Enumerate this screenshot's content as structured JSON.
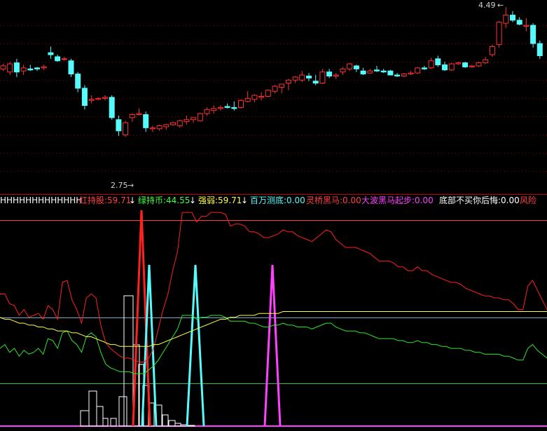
{
  "colors": {
    "background": "#000000",
    "bull": "#ff3232",
    "bear": "#54fcfc",
    "panel_divider": "#b80000",
    "dotted_grid": "#8b0000",
    "red_line": "#ff2020",
    "green_line": "#2ee62e",
    "yellow_line": "#ffff44",
    "white_bars": "#ffffff",
    "cyan_spike": "#54fcfc",
    "magenta_spike": "#ff40ff",
    "ref_line_upper": "#ff4040",
    "ref_line_mid": "#78a8c8",
    "ref_line_lower": "#40c040",
    "baseline": "#ff40ff"
  },
  "price_panel": {
    "high_label": "4.49",
    "low_label": "2.75",
    "high_arrow": "←",
    "low_arrow": "→"
  },
  "indicator_legend": [
    {
      "text": "HHHHHHHHHHHHH",
      "color": "#ffffff"
    },
    {
      "text": "红持股:59.71",
      "color": "#ff4040"
    },
    {
      "text": "↓",
      "color": "#ffffff"
    },
    {
      "text": "绿持币:44.55",
      "color": "#40ff40"
    },
    {
      "text": "↓",
      "color": "#ffffff"
    },
    {
      "text": "强弱:59.71",
      "color": "#ffff44"
    },
    {
      "text": "↓",
      "color": "#ffffff"
    },
    {
      "text": "百万测底:0.00",
      "color": "#54fcfc"
    },
    {
      "text": "灵桥黑马:0.00",
      "color": "#ff4040"
    },
    {
      "text": "大波黑马起步:0.00",
      "color": "#ff40ff"
    },
    {
      "text": "底部不买你后悔:0.00",
      "color": "#ffffff"
    },
    {
      "text": "风险",
      "color": "#ff4040"
    }
  ],
  "chart_data": [
    {
      "type": "candlestick",
      "title": "",
      "ylim": [
        2.75,
        4.49
      ],
      "annotations": [
        {
          "text": "4.49",
          "at": "high"
        },
        {
          "text": "2.75",
          "at": "low"
        }
      ],
      "ohlc": [
        [
          3.88,
          3.93,
          3.86,
          3.91
        ],
        [
          3.85,
          3.95,
          3.82,
          3.93
        ],
        [
          3.94,
          3.98,
          3.8,
          3.85
        ],
        [
          3.86,
          3.92,
          3.82,
          3.89
        ],
        [
          3.88,
          3.92,
          3.86,
          3.87
        ],
        [
          3.89,
          3.9,
          3.86,
          3.88
        ],
        [
          3.89,
          3.92,
          3.87,
          3.9
        ],
        [
          4.04,
          4.1,
          3.98,
          4.02
        ],
        [
          4.0,
          4.02,
          3.95,
          3.96
        ],
        [
          3.98,
          4.0,
          3.96,
          3.98
        ],
        [
          3.96,
          3.98,
          3.8,
          3.83
        ],
        [
          3.83,
          3.85,
          3.65,
          3.69
        ],
        [
          3.69,
          3.72,
          3.48,
          3.52
        ],
        [
          3.57,
          3.62,
          3.54,
          3.58
        ],
        [
          3.58,
          3.6,
          3.57,
          3.59
        ],
        [
          3.59,
          3.62,
          3.57,
          3.6
        ],
        [
          3.6,
          3.62,
          3.38,
          3.4
        ],
        [
          3.38,
          3.42,
          3.22,
          3.27
        ],
        [
          3.23,
          3.37,
          3.21,
          3.35
        ],
        [
          3.4,
          3.44,
          3.36,
          3.43
        ],
        [
          3.43,
          3.49,
          3.42,
          3.44
        ],
        [
          3.43,
          3.46,
          3.26,
          3.3
        ],
        [
          3.29,
          3.32,
          3.26,
          3.3
        ],
        [
          3.29,
          3.33,
          3.27,
          3.32
        ],
        [
          3.31,
          3.34,
          3.28,
          3.33
        ],
        [
          3.33,
          3.36,
          3.32,
          3.35
        ],
        [
          3.32,
          3.38,
          3.3,
          3.37
        ],
        [
          3.36,
          3.42,
          3.33,
          3.38
        ],
        [
          3.38,
          3.4,
          3.35,
          3.4
        ],
        [
          3.37,
          3.45,
          3.36,
          3.44
        ],
        [
          3.44,
          3.5,
          3.42,
          3.48
        ],
        [
          3.47,
          3.52,
          3.44,
          3.49
        ],
        [
          3.49,
          3.52,
          3.47,
          3.5
        ],
        [
          3.51,
          3.54,
          3.49,
          3.5
        ],
        [
          3.5,
          3.56,
          3.47,
          3.49
        ],
        [
          3.5,
          3.58,
          3.49,
          3.57
        ],
        [
          3.56,
          3.66,
          3.55,
          3.59
        ],
        [
          3.58,
          3.63,
          3.55,
          3.62
        ],
        [
          3.6,
          3.65,
          3.57,
          3.61
        ],
        [
          3.61,
          3.68,
          3.6,
          3.67
        ],
        [
          3.66,
          3.72,
          3.64,
          3.71
        ],
        [
          3.7,
          3.73,
          3.64,
          3.73
        ],
        [
          3.74,
          3.78,
          3.67,
          3.77
        ],
        [
          3.77,
          3.81,
          3.74,
          3.8
        ],
        [
          3.77,
          3.86,
          3.75,
          3.82
        ],
        [
          3.81,
          3.84,
          3.76,
          3.79
        ],
        [
          3.76,
          3.82,
          3.72,
          3.74
        ],
        [
          3.74,
          3.88,
          3.73,
          3.85
        ],
        [
          3.85,
          3.88,
          3.79,
          3.81
        ],
        [
          3.81,
          3.84,
          3.78,
          3.82
        ],
        [
          3.85,
          3.9,
          3.82,
          3.88
        ],
        [
          3.88,
          3.94,
          3.86,
          3.93
        ],
        [
          3.91,
          3.92,
          3.85,
          3.88
        ],
        [
          3.86,
          3.89,
          3.82,
          3.83
        ],
        [
          3.84,
          3.88,
          3.83,
          3.86
        ],
        [
          3.87,
          3.91,
          3.85,
          3.86
        ],
        [
          3.86,
          3.88,
          3.84,
          3.85
        ],
        [
          3.86,
          3.87,
          3.82,
          3.82
        ],
        [
          3.82,
          3.84,
          3.8,
          3.81
        ],
        [
          3.81,
          3.84,
          3.8,
          3.83
        ],
        [
          3.83,
          3.86,
          3.82,
          3.84
        ],
        [
          3.84,
          3.9,
          3.83,
          3.89
        ],
        [
          3.89,
          3.91,
          3.87,
          3.88
        ],
        [
          3.89,
          3.99,
          3.88,
          3.96
        ],
        [
          3.98,
          4.01,
          3.9,
          3.92
        ],
        [
          3.92,
          3.95,
          3.86,
          3.87
        ],
        [
          3.87,
          3.94,
          3.86,
          3.93
        ],
        [
          3.93,
          3.95,
          3.92,
          3.94
        ],
        [
          3.94,
          3.95,
          3.89,
          3.9
        ],
        [
          3.9,
          3.92,
          3.89,
          3.91
        ],
        [
          3.91,
          3.95,
          3.9,
          3.94
        ],
        [
          3.94,
          4.0,
          3.93,
          3.97
        ],
        [
          4.02,
          4.12,
          4.0,
          4.1
        ],
        [
          4.12,
          4.35,
          4.09,
          4.34
        ],
        [
          4.33,
          4.49,
          4.28,
          4.41
        ],
        [
          4.41,
          4.45,
          4.34,
          4.36
        ],
        [
          4.36,
          4.39,
          4.31,
          4.32
        ],
        [
          4.3,
          4.38,
          4.25,
          4.31
        ],
        [
          4.31,
          4.33,
          4.09,
          4.13
        ],
        [
          4.13,
          4.16,
          3.98,
          4.01
        ]
      ]
    },
    {
      "type": "line",
      "title": "",
      "ylim": [
        0,
        100
      ],
      "series": [
        {
          "name": "红持股",
          "values": [
            68,
            68,
            63,
            62,
            57,
            60,
            56,
            57,
            58,
            55,
            62,
            60,
            55,
            74,
            75,
            65,
            60,
            53,
            66,
            68,
            66,
            52,
            43,
            40,
            38,
            36,
            35,
            35,
            34,
            33,
            33,
            35,
            40,
            50,
            60,
            68,
            80,
            90,
            110,
            110,
            110,
            105,
            108,
            108,
            110,
            110,
            110,
            109,
            103,
            104,
            104,
            103,
            100,
            100,
            99,
            97,
            97,
            98,
            99,
            101,
            100,
            100,
            98,
            97,
            96,
            95,
            97,
            99,
            101,
            100,
            96,
            94,
            92,
            92,
            92,
            91,
            90,
            89,
            87,
            85,
            85,
            85,
            84,
            82,
            82,
            80,
            80,
            82,
            80,
            80,
            78,
            77,
            76,
            75,
            74,
            74,
            73,
            71,
            70,
            69,
            68,
            67,
            67,
            66,
            66,
            65,
            65,
            63,
            60,
            60,
            72,
            75,
            70,
            65,
            60
          ]
        },
        {
          "name": "绿持币",
          "values": [
            40,
            42,
            38,
            40,
            36,
            39,
            37,
            38,
            40,
            37,
            45,
            44,
            40,
            48,
            49,
            44,
            42,
            38,
            46,
            48,
            46,
            38,
            32,
            30,
            29,
            28,
            28,
            28,
            27,
            27,
            27,
            29,
            31,
            34,
            38,
            42,
            46,
            50,
            57,
            57,
            57,
            55,
            56,
            56,
            57,
            57,
            57,
            56,
            54,
            54,
            54,
            54,
            53,
            53,
            52,
            51,
            51,
            52,
            52,
            53,
            52,
            52,
            51,
            51,
            51,
            50,
            51,
            52,
            53,
            53,
            51,
            50,
            49,
            49,
            49,
            48,
            48,
            47,
            46,
            45,
            45,
            45,
            45,
            44,
            44,
            43,
            43,
            44,
            43,
            43,
            42,
            42,
            41,
            41,
            40,
            40,
            40,
            39,
            39,
            38,
            38,
            37,
            37,
            37,
            37,
            36,
            36,
            35,
            34,
            34,
            40,
            42,
            39,
            37,
            35
          ]
        },
        {
          "name": "强弱",
          "values": [
            56,
            55,
            55,
            54,
            53,
            53,
            52,
            52,
            51,
            51,
            50,
            50,
            49,
            49,
            49,
            48,
            48,
            47,
            46,
            46,
            45,
            44,
            43,
            42,
            42,
            41,
            41,
            41,
            41,
            41,
            41,
            41,
            42,
            42,
            43,
            44,
            45,
            46,
            47,
            48,
            49,
            50,
            51,
            52,
            53,
            54,
            55,
            55,
            56,
            56,
            57,
            57,
            57,
            57,
            58,
            58,
            58,
            58,
            58,
            59,
            59,
            59,
            59,
            59,
            59,
            59,
            59,
            59,
            59,
            59,
            59,
            59,
            59,
            59,
            59,
            59,
            59,
            59,
            59,
            59,
            59,
            59,
            59,
            59,
            59,
            59,
            59,
            59,
            59,
            59,
            59,
            59,
            59,
            59,
            59,
            59,
            59,
            59,
            59,
            59,
            59,
            59,
            59,
            59,
            59,
            59,
            59,
            59,
            59,
            59,
            59,
            59,
            59,
            59,
            59
          ]
        }
      ]
    }
  ]
}
